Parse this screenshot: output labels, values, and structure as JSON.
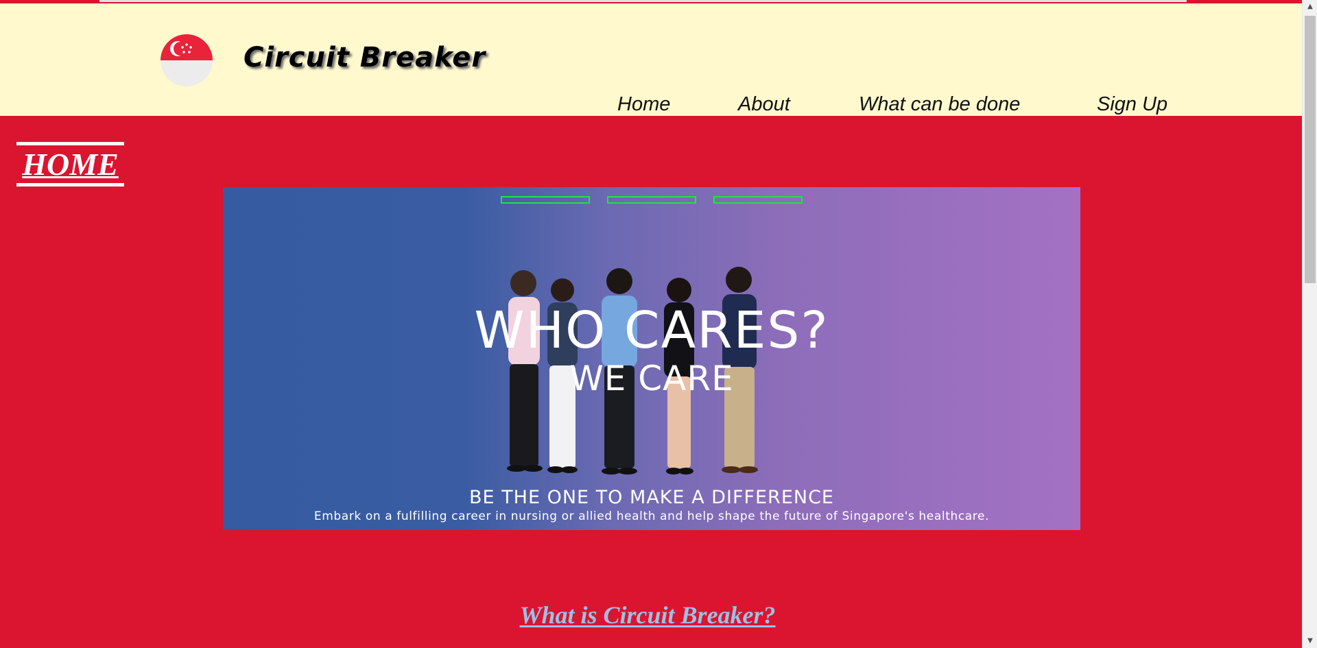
{
  "header": {
    "title": "Circuit Breaker",
    "logo_icon": "singapore-flag-icon",
    "background": "#fff9cd"
  },
  "nav": {
    "items": [
      {
        "label": "Home"
      },
      {
        "label": "About"
      },
      {
        "label": "What can be done"
      },
      {
        "label": "Sign Up"
      }
    ]
  },
  "page": {
    "heading": "HOME",
    "background": "#db1430"
  },
  "carousel": {
    "indicator_count": 3,
    "indicator_color": "#1ee53f",
    "slide": {
      "title": "WHO CARES?",
      "subtitle": "WE CARE",
      "cta": "BE THE ONE TO MAKE A DIFFERENCE",
      "description": "Embark on a fulfilling career in nursing or allied health and help shape the future of Singapore's healthcare."
    }
  },
  "section": {
    "link_text": "What is Circuit Breaker?",
    "link_color": "#9cc0e6"
  },
  "scrollbar": {
    "up_icon": "scroll-up-arrow-icon",
    "down_icon": "scroll-down-arrow-icon"
  }
}
